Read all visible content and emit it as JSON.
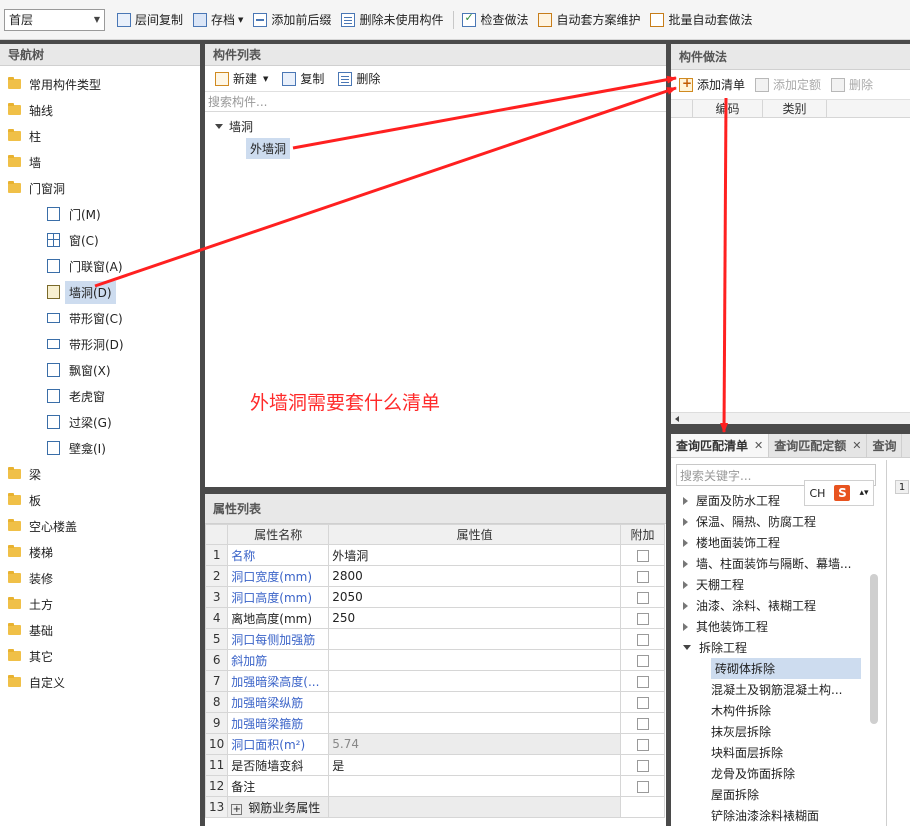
{
  "toolbar": {
    "floor": "首层",
    "buttons": [
      "层间复制",
      "存档",
      "添加前后缀",
      "删除未使用构件",
      "检查做法",
      "自动套方案维护",
      "批量自动套做法"
    ]
  },
  "nav": {
    "title": "导航树",
    "groups_top": [
      "常用构件类型",
      "轴线",
      "柱",
      "墙",
      "门窗洞"
    ],
    "children": [
      "门(M)",
      "窗(C)",
      "门联窗(A)",
      "墙洞(D)",
      "带形窗(C)",
      "带形洞(D)",
      "飘窗(X)",
      "老虎窗",
      "过梁(G)",
      "壁龛(I)"
    ],
    "groups_bottom": [
      "梁",
      "板",
      "空心楼盖",
      "楼梯",
      "装修",
      "土方",
      "基础",
      "其它",
      "自定义"
    ]
  },
  "component_list": {
    "title": "构件列表",
    "new_label": "新建",
    "copy_label": "复制",
    "delete_label": "删除",
    "search_placeholder": "搜索构件...",
    "parent": "墙洞",
    "child": "外墙洞"
  },
  "annotation": "外墙洞需要套什么清单",
  "properties": {
    "title": "属性列表",
    "headers": [
      "属性名称",
      "属性值",
      "附加"
    ],
    "rows": [
      {
        "num": "1",
        "name": "名称",
        "value": "外墙洞"
      },
      {
        "num": "2",
        "name": "洞口宽度(mm)",
        "value": "2800"
      },
      {
        "num": "3",
        "name": "洞口高度(mm)",
        "value": "2050"
      },
      {
        "num": "4",
        "name": "离地高度(mm)",
        "value": "250"
      },
      {
        "num": "5",
        "name": "洞口每侧加强筋",
        "value": ""
      },
      {
        "num": "6",
        "name": "斜加筋",
        "value": ""
      },
      {
        "num": "7",
        "name": "加强暗梁高度(...",
        "value": ""
      },
      {
        "num": "8",
        "name": "加强暗梁纵筋",
        "value": ""
      },
      {
        "num": "9",
        "name": "加强暗梁箍筋",
        "value": ""
      },
      {
        "num": "10",
        "name": "洞口面积(m²)",
        "value": "5.74"
      },
      {
        "num": "11",
        "name": "是否随墙变斜",
        "value": "是"
      },
      {
        "num": "12",
        "name": "备注",
        "value": ""
      },
      {
        "num": "13",
        "name": "钢筋业务属性",
        "value": ""
      }
    ]
  },
  "method": {
    "title": "构件做法",
    "add_list": "添加清单",
    "add_quota": "添加定额",
    "delete": "删除",
    "col_code": "编码",
    "col_type": "类别"
  },
  "query": {
    "tab1": "查询匹配清单",
    "tab2": "查询匹配定额",
    "tab3": "查询",
    "search_placeholder": "搜索关键字...",
    "ime_label": "CH",
    "ime_s": "S",
    "strip_num": "1",
    "categories": [
      "屋面及防水工程",
      "保温、隔热、防腐工程",
      "楼地面装饰工程",
      "墙、柱面装饰与隔断、幕墙...",
      "天棚工程",
      "油漆、涂料、裱糊工程",
      "其他装饰工程",
      "拆除工程"
    ],
    "subitems": [
      "砖砌体拆除",
      "混凝土及钢筋混凝土构...",
      "木构件拆除",
      "抹灰层拆除",
      "块料面层拆除",
      "龙骨及饰面拆除",
      "屋面拆除",
      "铲除油漆涂料裱糊面"
    ]
  }
}
